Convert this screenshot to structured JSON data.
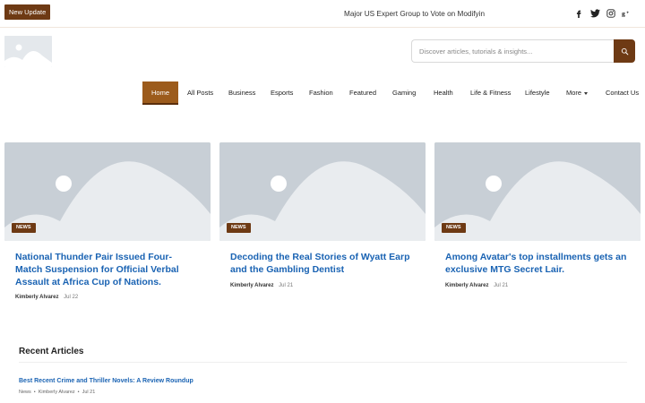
{
  "topbar": {
    "badge": "New Update",
    "ticker": "Major US Expert Group to Vote on Modifyin",
    "social": [
      {
        "icon": "facebook-icon",
        "glyph": "f"
      },
      {
        "icon": "twitter-icon",
        "glyph": "🐦"
      },
      {
        "icon": "instagram-icon",
        "glyph": ""
      },
      {
        "icon": "google-plus-icon",
        "glyph": "g+"
      }
    ]
  },
  "header": {
    "search_placeholder": "Discover articles, tutorials & insights..."
  },
  "nav": {
    "items": [
      "Home",
      "All Posts",
      "Business",
      "Esports",
      "Fashion",
      "Featured",
      "Gaming",
      "Health",
      "Life & Fitness",
      "Lifestyle",
      "More",
      "Contact Us"
    ]
  },
  "cards": [
    {
      "badge": "NEWS",
      "title": "National Thunder Pair Issued Four-Match Suspension for Official Verbal Assault at Africa Cup of Nations.",
      "author": "Kimberly Alvarez",
      "date": "Jul 22"
    },
    {
      "badge": "NEWS",
      "title": "Decoding the Real Stories of Wyatt Earp and the Gambling Dentist",
      "author": "Kimberly Alvarez",
      "date": "Jul 21"
    },
    {
      "badge": "NEWS",
      "title": "Among Avatar's top installments gets an exclusive MTG Secret Lair.",
      "author": "Kimberly Alvarez",
      "date": "Jul 21"
    }
  ],
  "recent": {
    "heading": "Recent Articles",
    "items": [
      {
        "title": "Best Recent Crime and Thriller Novels: A Review Roundup",
        "category": "News",
        "author": "Kimberly Alvarez",
        "date": "Jul 21"
      }
    ]
  },
  "colors": {
    "accent": "#6e3a14",
    "nav_active": "#9c5b1c",
    "link": "#1a63b3",
    "placeholder_bg": "#c8cfd6"
  }
}
